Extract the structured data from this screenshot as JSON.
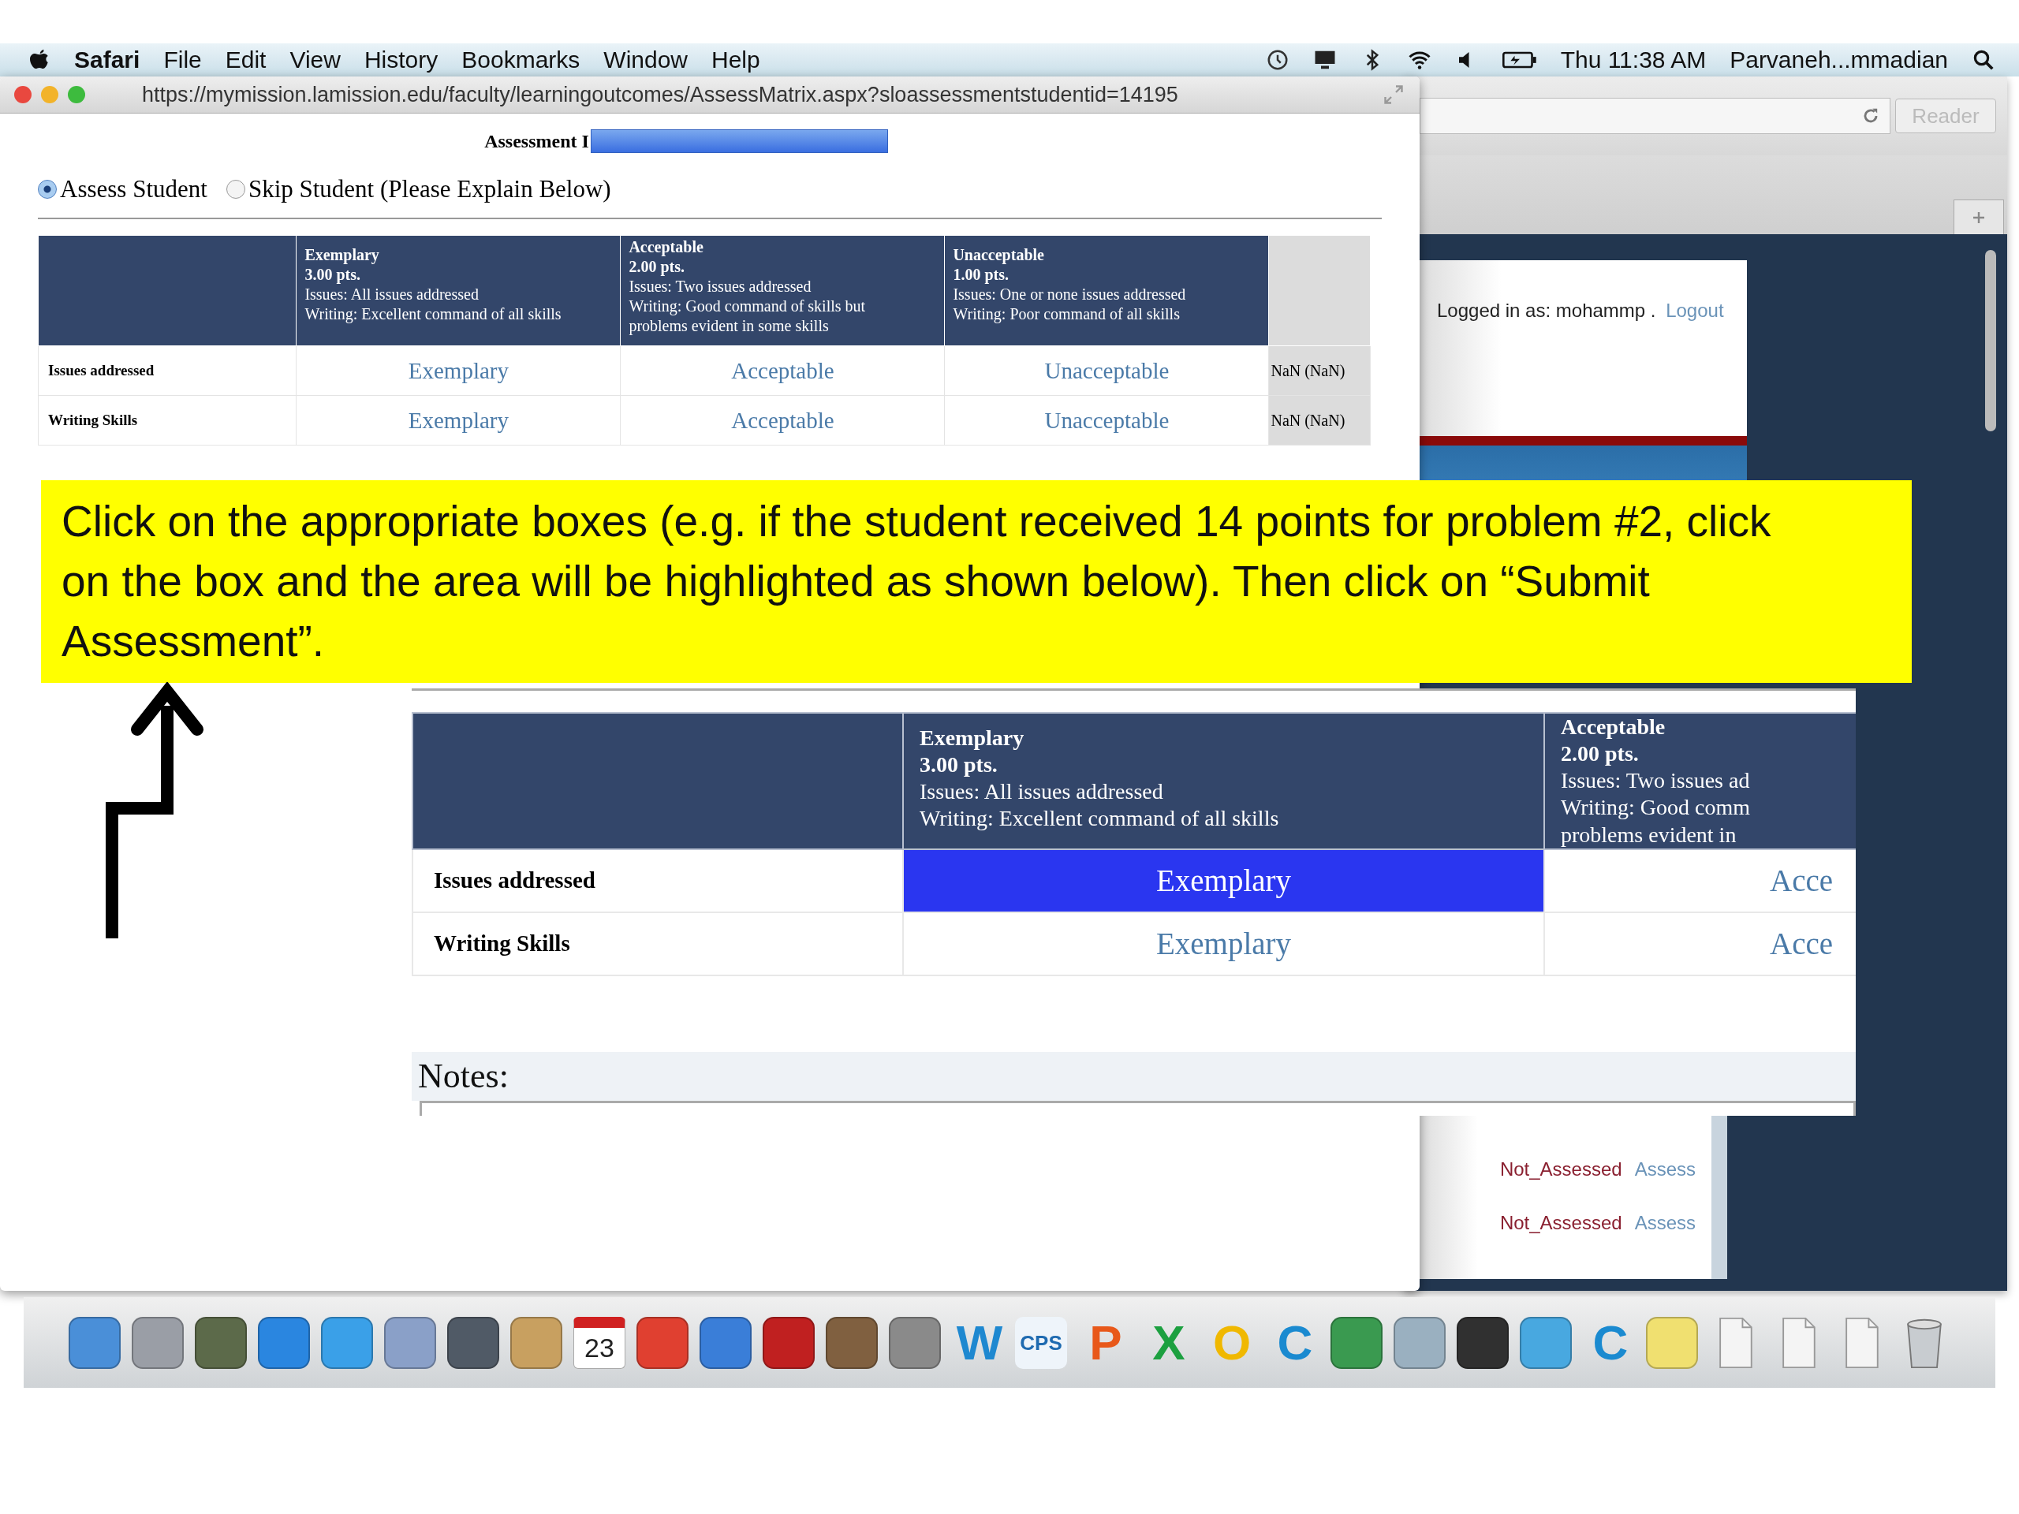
{
  "menu_bar": {
    "app": "Safari",
    "menus": [
      "File",
      "Edit",
      "View",
      "History",
      "Bookmarks",
      "Window",
      "Help"
    ],
    "clock": "Thu 11:38 AM",
    "user": "Parvaneh...mmadian"
  },
  "front_window": {
    "url": "https://mymission.lamission.edu/faculty/learningoutcomes/AssessMatrix.aspx?sloassessmentstudentid=14195",
    "heading": "Assessment I",
    "options": [
      {
        "label": "Assess Student",
        "selected": true
      },
      {
        "label": "Skip Student (Please Explain Below)",
        "selected": false
      }
    ],
    "levels": [
      {
        "title": "Exemplary",
        "points": "3.00 pts.",
        "lines": [
          "Issues: All issues addressed",
          "Writing: Excellent command of all skills"
        ]
      },
      {
        "title": "Acceptable",
        "points": "2.00 pts.",
        "lines": [
          "Issues: Two issues addressed",
          "Writing: Good command of skills but",
          "problems evident in some skills"
        ]
      },
      {
        "title": "Unacceptable",
        "points": "1.00 pts.",
        "lines": [
          "Issues: One or none issues addressed",
          "Writing: Poor command of all skills"
        ]
      }
    ],
    "rows": [
      {
        "criterion": "Issues addressed",
        "cells": [
          {
            "label": "Exemplary",
            "selected": false
          },
          {
            "label": "Acceptable",
            "selected": false
          },
          {
            "label": "Unacceptable",
            "selected": false
          }
        ],
        "score": "NaN (NaN)"
      },
      {
        "criterion": "Writing Skills",
        "cells": [
          {
            "label": "Exemplary",
            "selected": false
          },
          {
            "label": "Acceptable",
            "selected": false
          },
          {
            "label": "Unacceptable",
            "selected": false
          }
        ],
        "score": "NaN (NaN)"
      }
    ]
  },
  "callout": {
    "text": "Click on the appropriate boxes (e.g. if the student received 14 points for problem #2, click on the box and the area will be highlighted as shown below).  Then click on “Submit Assessment”."
  },
  "zoom_inset": {
    "levels": [
      {
        "title": "Exemplary",
        "points": "3.00 pts.",
        "lines": [
          "Issues: All issues addressed",
          "Writing: Excellent command of all skills"
        ]
      },
      {
        "title": "Acceptable",
        "points": "2.00 pts.",
        "lines": [
          "Issues: Two issues ad",
          "Writing: Good comm",
          "problems evident in"
        ]
      }
    ],
    "rows": [
      {
        "criterion": "Issues addressed",
        "cells": [
          {
            "label": "Exemplary",
            "selected": true
          },
          {
            "label": "Acce",
            "selected": false
          }
        ]
      },
      {
        "criterion": "Writing Skills",
        "cells": [
          {
            "label": "Exemplary",
            "selected": false
          },
          {
            "label": "Acce",
            "selected": false
          }
        ]
      }
    ],
    "notes_label": "Notes:"
  },
  "back_window": {
    "reader_button": "Reader",
    "login_text": "Logged in as: mohammp .",
    "logout_link": "Logout",
    "rows": [
      {
        "status": "Not_Assessed",
        "action": "Assess"
      },
      {
        "status": "Not_Assessed",
        "action": "Assess"
      }
    ]
  },
  "dock": [
    {
      "kind": "tile",
      "color": "#4a8fd8"
    },
    {
      "kind": "tile",
      "color": "#9a9ea6"
    },
    {
      "kind": "tile",
      "color": "#5c6a4a"
    },
    {
      "kind": "tile",
      "color": "#2a86e0"
    },
    {
      "kind": "tile",
      "color": "#3aa0e8"
    },
    {
      "kind": "tile",
      "color": "#8aa0c8"
    },
    {
      "kind": "tile",
      "color": "#505a66"
    },
    {
      "kind": "tile",
      "color": "#c8a060"
    },
    {
      "kind": "calendar",
      "label": "23"
    },
    {
      "kind": "tile",
      "color": "#e04030"
    },
    {
      "kind": "tile",
      "color": "#3a7ed8"
    },
    {
      "kind": "tile",
      "color": "#c02020"
    },
    {
      "kind": "tile",
      "color": "#806040"
    },
    {
      "kind": "tile",
      "color": "#8a8a8a"
    },
    {
      "kind": "letter",
      "label": "W",
      "color": "#1e88d0"
    },
    {
      "kind": "letter",
      "label": "CPS",
      "color": "#1e6ab0"
    },
    {
      "kind": "letter",
      "label": "P",
      "color": "#e8581a"
    },
    {
      "kind": "letter",
      "label": "X",
      "color": "#1ca040"
    },
    {
      "kind": "letter",
      "label": "O",
      "color": "#f0b800"
    },
    {
      "kind": "letter",
      "label": "C",
      "color": "#1a8ad0"
    },
    {
      "kind": "tile",
      "color": "#3a9a50"
    },
    {
      "kind": "tile",
      "color": "#9ab0c0"
    },
    {
      "kind": "tile",
      "color": "#303030"
    },
    {
      "kind": "tile",
      "color": "#48a8e0"
    },
    {
      "kind": "letter",
      "label": "C",
      "color": "#1a8ad0"
    },
    {
      "kind": "tile",
      "color": "#f0e070"
    },
    {
      "kind": "doc"
    },
    {
      "kind": "doc"
    },
    {
      "kind": "doc"
    },
    {
      "kind": "trash"
    }
  ]
}
